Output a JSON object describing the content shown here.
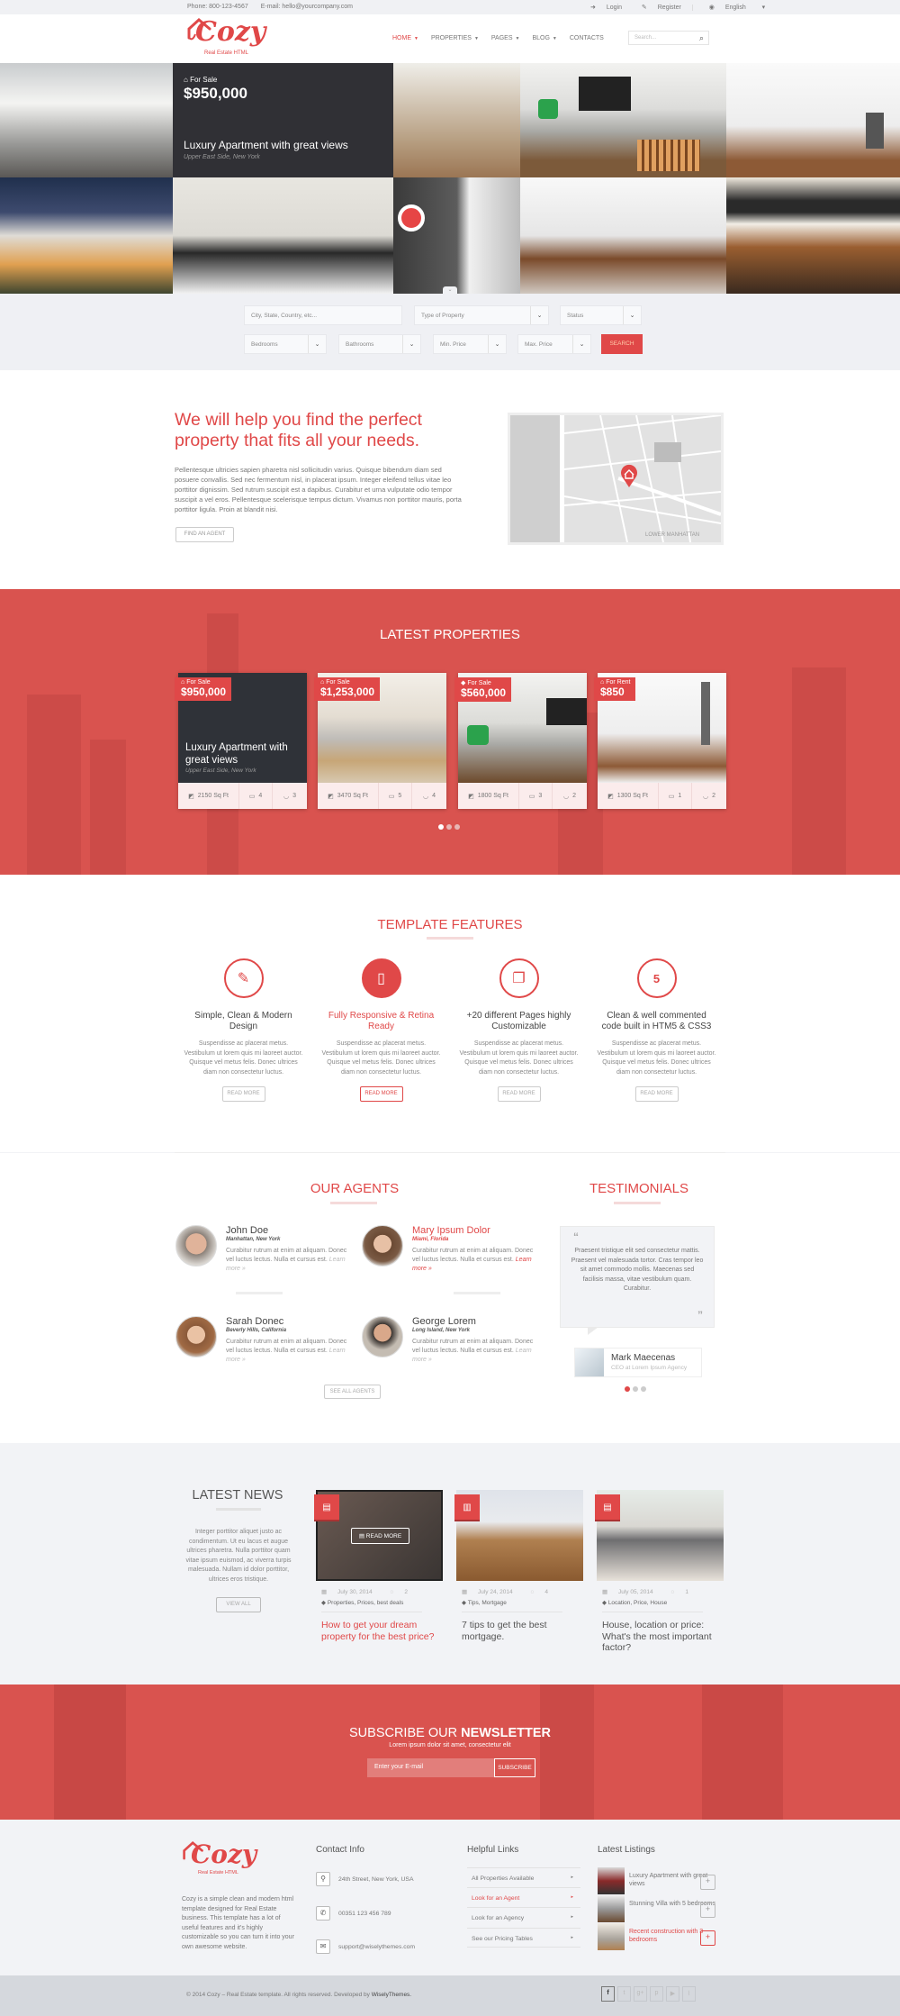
{
  "topbar": {
    "phone": "Phone: 800-123-4567",
    "email": "E-mail: hello@yourcompany.com",
    "login": "Login",
    "register": "Register",
    "language": "English"
  },
  "header": {
    "logo_word": "Cozy",
    "logo_tagline": "Real Estate HTML",
    "nav": [
      {
        "label": "HOME",
        "dropdown": true,
        "active": true
      },
      {
        "label": "PROPERTIES",
        "dropdown": true
      },
      {
        "label": "PAGES",
        "dropdown": true
      },
      {
        "label": "BLOG",
        "dropdown": true
      },
      {
        "label": "CONTACTS",
        "dropdown": false
      }
    ],
    "search_placeholder": "Search..."
  },
  "hero": {
    "status": "For Sale",
    "price": "$950,000",
    "title": "Luxury Apartment with great views",
    "location": "Upper East Side, New York"
  },
  "filters": {
    "location_placeholder": "City, State, Country, etc...",
    "type": "Type of Property",
    "status": "Status",
    "bedrooms": "Bedrooms",
    "bathrooms": "Bathrooms",
    "min_price": "Min. Price",
    "max_price": "Max. Price",
    "search_button": "SEARCH"
  },
  "intro": {
    "heading": "We will help you find the perfect property that fits all your needs.",
    "body": "Pellentesque ultricies sapien pharetra nisl sollicitudin varius. Quisque bibendum diam sed posuere convallis. Sed nec fermentum nisl, in placerat ipsum. Integer eleifend tellus vitae leo porttitor dignissim. Sed rutrum suscipit est a dapibus. Curabitur et urna vulputate odio tempor suscipit a vel eros. Pellentesque scelerisque tempus dictum. Vivamus non porttitor mauris, porta porttitor ligula. Proin at blandit nisi.",
    "button": "FIND AN AGENT"
  },
  "latest_properties": {
    "title": "LATEST PROPERTIES",
    "items": [
      {
        "status": "For Sale",
        "price": "$950,000",
        "title": "Luxury Apartment with great views",
        "location": "Upper East Side, New York",
        "area": "2150 Sq Ft",
        "beds": "4",
        "baths": "3"
      },
      {
        "status": "For Sale",
        "price": "$1,253,000",
        "area": "3470 Sq Ft",
        "beds": "5",
        "baths": "4"
      },
      {
        "status": "For Sale",
        "price": "$560,000",
        "area": "1800 Sq Ft",
        "beds": "3",
        "baths": "2"
      },
      {
        "status": "For Rent",
        "price": "$850",
        "area": "1300 Sq Ft",
        "beds": "1",
        "baths": "2"
      }
    ],
    "pages": 3,
    "active_page": 1
  },
  "features": {
    "title": "TEMPLATE FEATURES",
    "items": [
      {
        "icon": "pencil-icon",
        "title": "Simple, Clean & Modern Design",
        "text": "Suspendisse ac placerat metus. Vestibulum ut lorem quis mi laoreet auctor. Quisque vel metus felis. Donec ultrices diam non consectetur luctus.",
        "button": "READ MORE",
        "highlight": false
      },
      {
        "icon": "tablet-icon",
        "title": "Fully Responsive & Retina Ready",
        "text": "Suspendisse ac placerat metus. Vestibulum ut lorem quis mi laoreet auctor. Quisque vel metus felis. Donec ultrices diam non consectetur luctus.",
        "button": "READ MORE",
        "highlight": true
      },
      {
        "icon": "copy-icon",
        "title": "+20 different Pages highly Customizable",
        "text": "Suspendisse ac placerat metus. Vestibulum ut lorem quis mi laoreet auctor. Quisque vel metus felis. Donec ultrices diam non consectetur luctus.",
        "button": "READ MORE",
        "highlight": false
      },
      {
        "icon": "html5-icon",
        "title": "Clean & well commented code built in HTM5 & CSS3",
        "text": "Suspendisse ac placerat metus. Vestibulum ut lorem quis mi laoreet auctor. Quisque vel metus felis. Donec ultrices diam non consectetur luctus.",
        "button": "READ MORE",
        "highlight": false
      }
    ]
  },
  "agents": {
    "title": "OUR AGENTS",
    "items": [
      {
        "name": "John Doe",
        "location": "Manhattan, New York",
        "text": "Curabitur rutrum at enim at aliquam. Donec vel luctus lectus. Nulla et cursus est.",
        "link": "Learn more »",
        "highlight": false
      },
      {
        "name": "Mary Ipsum Dolor",
        "location": "Miami, Florida",
        "text": "Curabitur rutrum at enim at aliquam. Donec vel luctus lectus. Nulla et cursus est.",
        "link": "Learn more »",
        "highlight": true
      },
      {
        "name": "Sarah  Donec",
        "location": "Beverly Hills, California",
        "text": "Curabitur rutrum at enim at aliquam. Donec vel luctus lectus. Nulla et cursus est.",
        "link": "Learn more »",
        "highlight": false
      },
      {
        "name": "George Lorem",
        "location": "Long Island, New York",
        "text": "Curabitur rutrum at enim at aliquam. Donec vel luctus lectus. Nulla et cursus est.",
        "link": "Learn more »",
        "highlight": false
      }
    ],
    "button": "SEE ALL AGENTS"
  },
  "testimonials": {
    "title": "TESTIMONIALS",
    "quote": "Praesent tristique elit sed consectetur mattis. Praesent vel malesuada tortor. Cras tempor leo sit amet commodo mollis. Maecenas sed facilisis massa, vitae vestibulum quam. Curabitur.",
    "name": "Mark Maecenas",
    "role": "CEO at Lorem Ipsum Agency",
    "pages": 3,
    "active_page": 1
  },
  "news": {
    "title": "LATEST NEWS",
    "intro": "Integer porttitor aliquet justo ac condimentum. Ut eu lacus et augue ultrices pharetra. Nulla porttitor quam vitae ipsum euismod, ac viverra turpis malesuada. Nullam id dolor porttitor, ultrices eros tristique.",
    "button": "VIEW ALL",
    "read_more": "READ MORE",
    "posts": [
      {
        "type_icon": "document-icon",
        "date": "July 30, 2014",
        "comments": "2",
        "tags": "Properties, Prices, best deals",
        "title": "How to get your dream property for the best price?",
        "highlight": true
      },
      {
        "type_icon": "film-icon",
        "date": "July 24, 2014",
        "comments": "4",
        "tags": "Tips, Mortgage",
        "title": "7 tips to get the best mortgage.",
        "highlight": false
      },
      {
        "type_icon": "document-icon",
        "date": "July 05, 2014",
        "comments": "1",
        "tags": "Location, Price, House",
        "title": "House, location or price: What's the most important factor?",
        "highlight": false
      }
    ]
  },
  "newsletter": {
    "title_light": "SUBSCRIBE OUR ",
    "title_bold": "NEWSLETTER",
    "subtitle": "Lorem ipsum dolor sit amet, consectetur elit",
    "placeholder": "Enter your E-mail",
    "button": "SUBSCRIBE"
  },
  "footer": {
    "logo_word": "Cozy",
    "logo_tagline": "Real Estate HTML",
    "description": "Cozy  is a simple clean and modern html template designed for Real Estate business. This template has a lot of useful features and it's highly customizable so you can turn it into your own awesome website.",
    "contact_title": "Contact Info",
    "address": "24th Street, New York, USA",
    "phone": "00351 123 456 789",
    "email": "support@wiselythemes.com",
    "links_title": "Helpful Links",
    "links": [
      {
        "label": "All Properties Available",
        "active": false
      },
      {
        "label": "Look for an Agent",
        "active": true
      },
      {
        "label": "Look for an Agency",
        "active": false
      },
      {
        "label": "See our Pricing Tables",
        "active": false
      }
    ],
    "listings_title": "Latest Listings",
    "listings": [
      {
        "title": "Luxury Apartment with great views",
        "active": false
      },
      {
        "title": "Stunning Villa with 5 bedrooms",
        "active": false
      },
      {
        "title": "Recent construction with 3 bedrooms",
        "active": true
      }
    ],
    "copyright": "© 2014 Cozy – Real Estate template. All rights reserved. Developed by ",
    "developer": "WiselyThemes.",
    "social": [
      "facebook-icon",
      "twitter-icon",
      "google-plus-icon",
      "pinterest-icon",
      "youtube-icon",
      "rss-icon"
    ]
  },
  "colors": {
    "accent": "#e04848",
    "background": "#f2f3f6",
    "footer_bottom": "#d5d8dd"
  }
}
